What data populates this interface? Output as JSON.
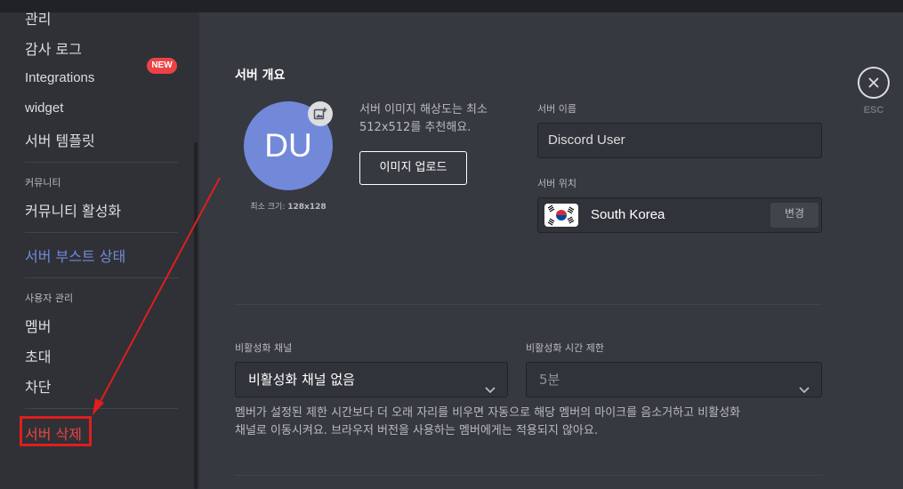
{
  "sidebar": {
    "items": {
      "manage": "관리",
      "audit_log": "감사 로그",
      "integrations": "Integrations",
      "integrations_badge": "NEW",
      "widget": "widget",
      "template": "서버 템플릿",
      "community_header": "커뮤니티",
      "community_enable": "커뮤니티 활성화",
      "boost": "서버 부스트 상태",
      "user_mgmt_header": "사용자 관리",
      "members": "멤버",
      "invites": "초대",
      "bans": "차단",
      "delete_server": "서버 삭제"
    }
  },
  "overview": {
    "title": "서버 개요",
    "avatar_initials": "DU",
    "min_size_label": "최소 크기:",
    "min_size_value": "128x128",
    "hint_line1": "서버 이미지 해상도는 최소",
    "hint_line2": "512x512를 추천해요.",
    "upload_label": "이미지 업로드",
    "name_label": "서버 이름",
    "name_value": "Discord User",
    "region_label": "서버 위치",
    "region_value": "South Korea",
    "change_label": "변경"
  },
  "afk": {
    "channel_label": "비활성화 채널",
    "channel_value": "비활성화 채널 없음",
    "timeout_label": "비활성화 시간 제한",
    "timeout_value": "5분",
    "note_line1": "멤버가 설정된 제한 시간보다 더 오래 자리를 비우면 자동으로 해당 멤버의 마이크를 음소거하고 비활성화",
    "note_line2": "채널로 이동시켜요. 브라우저 버전을 사용하는 멤버에게는 적용되지 않아요."
  },
  "close": {
    "esc_label": "ESC"
  },
  "colors": {
    "accent": "#7289da",
    "danger": "#ed4245",
    "annotation": "#e01e1e"
  },
  "icons": [
    "add-image-icon",
    "korea-flag-icon",
    "chevron-down-icon",
    "close-icon"
  ]
}
